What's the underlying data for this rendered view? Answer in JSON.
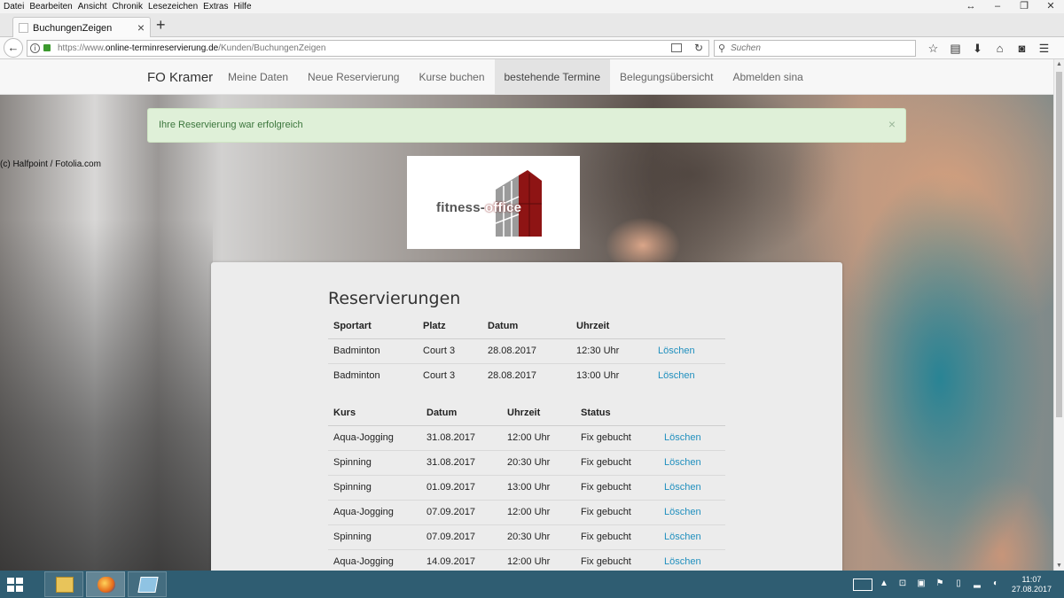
{
  "menubar": {
    "items": [
      "Datei",
      "Bearbeiten",
      "Ansicht",
      "Chronik",
      "Lesezeichen",
      "Extras",
      "Hilfe"
    ]
  },
  "window_controls": {
    "restore": "↔",
    "minimize": "–",
    "maximize": "❐",
    "close": "✕"
  },
  "browser": {
    "tab_title": "BuchungenZeigen",
    "tab_close": "×",
    "new_tab": "+",
    "back": "←",
    "url_prefix": "https://www.",
    "url_domain": "online-terminreservierung.de",
    "url_path": "/Kunden/BuchungenZeigen",
    "search_placeholder": "Suchen",
    "toolbar_icons": [
      "star-icon",
      "bookmarks-icon",
      "download-icon",
      "home-icon",
      "pocket-icon",
      "menu-icon"
    ]
  },
  "site": {
    "credit": "(c) Halfpoint / Fotolia.com",
    "brand": "FO Kramer",
    "nav": [
      "Meine Daten",
      "Neue Reservierung",
      "Kurse buchen",
      "bestehende Termine",
      "Belegungsübersicht",
      "Abmelden sina"
    ],
    "active_nav": "bestehende Termine",
    "alert": {
      "text": "Ihre Reservierung war erfolgreich",
      "close": "×"
    },
    "logo": {
      "part1": "fitness-",
      "part2": "office"
    }
  },
  "reservations": {
    "title": "Reservierungen",
    "court_headers": [
      "Sportart",
      "Platz",
      "Datum",
      "Uhrzeit"
    ],
    "court_rows": [
      {
        "sport": "Badminton",
        "platz": "Court 3",
        "datum": "28.08.2017",
        "uhrzeit": "12:30 Uhr",
        "action": "Löschen"
      },
      {
        "sport": "Badminton",
        "platz": "Court 3",
        "datum": "28.08.2017",
        "uhrzeit": "13:00 Uhr",
        "action": "Löschen"
      }
    ],
    "course_headers": [
      "Kurs",
      "Datum",
      "Uhrzeit",
      "Status"
    ],
    "course_rows": [
      {
        "kurs": "Aqua-Jogging",
        "datum": "31.08.2017",
        "uhrzeit": "12:00 Uhr",
        "status": "Fix gebucht",
        "action": "Löschen"
      },
      {
        "kurs": "Spinning",
        "datum": "31.08.2017",
        "uhrzeit": "20:30 Uhr",
        "status": "Fix gebucht",
        "action": "Löschen"
      },
      {
        "kurs": "Spinning",
        "datum": "01.09.2017",
        "uhrzeit": "13:00 Uhr",
        "status": "Fix gebucht",
        "action": "Löschen"
      },
      {
        "kurs": "Aqua-Jogging",
        "datum": "07.09.2017",
        "uhrzeit": "12:00 Uhr",
        "status": "Fix gebucht",
        "action": "Löschen"
      },
      {
        "kurs": "Spinning",
        "datum": "07.09.2017",
        "uhrzeit": "20:30 Uhr",
        "status": "Fix gebucht",
        "action": "Löschen"
      },
      {
        "kurs": "Aqua-Jogging",
        "datum": "14.09.2017",
        "uhrzeit": "12:00 Uhr",
        "status": "Fix gebucht",
        "action": "Löschen"
      }
    ]
  },
  "taskbar": {
    "apps": [
      "explorer-icon",
      "firefox-icon",
      "window-icon"
    ],
    "time": "11:07",
    "date": "27.08.2017"
  },
  "colors": {
    "link": "#1f8fbe",
    "alert_bg": "#dff0d8",
    "alert_text": "#3c763d",
    "taskbar": "#2f5d72",
    "logo_red": "#8e1414"
  }
}
